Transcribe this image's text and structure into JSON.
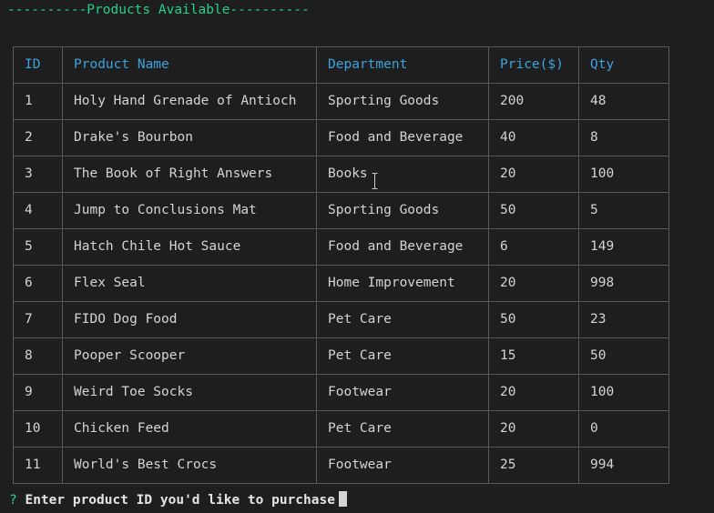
{
  "banner": "----------Products Available----------",
  "table": {
    "headers": {
      "id": "ID",
      "name": "Product Name",
      "department": "Department",
      "price": "Price($)",
      "qty": "Qty"
    },
    "rows": [
      {
        "id": "1",
        "name": "Holy Hand Grenade of Antioch",
        "department": "Sporting Goods",
        "price": "200",
        "qty": "48"
      },
      {
        "id": "2",
        "name": "Drake's Bourbon",
        "department": "Food and Beverage",
        "price": "40",
        "qty": "8"
      },
      {
        "id": "3",
        "name": "The Book of Right Answers",
        "department": "Books",
        "price": "20",
        "qty": "100"
      },
      {
        "id": "4",
        "name": "Jump to Conclusions Mat",
        "department": "Sporting Goods",
        "price": "50",
        "qty": "5"
      },
      {
        "id": "5",
        "name": "Hatch Chile Hot Sauce",
        "department": "Food and Beverage",
        "price": "6",
        "qty": "149"
      },
      {
        "id": "6",
        "name": "Flex Seal",
        "department": "Home Improvement",
        "price": "20",
        "qty": "998"
      },
      {
        "id": "7",
        "name": "FIDO Dog Food",
        "department": "Pet Care",
        "price": "50",
        "qty": "23"
      },
      {
        "id": "8",
        "name": "Pooper Scooper",
        "department": "Pet Care",
        "price": "15",
        "qty": "50"
      },
      {
        "id": "9",
        "name": "Weird Toe Socks",
        "department": "Footwear",
        "price": "20",
        "qty": "100"
      },
      {
        "id": "10",
        "name": "Chicken Feed",
        "department": "Pet Care",
        "price": "20",
        "qty": "0"
      },
      {
        "id": "11",
        "name": "World's Best Crocs",
        "department": "Footwear",
        "price": "25",
        "qty": "994"
      }
    ]
  },
  "prompt": {
    "marker": "?",
    "text": "Enter product ID you'd like to purchase"
  },
  "colors": {
    "background": "#1e1e1e",
    "banner": "#23d18b",
    "header_text": "#3ba3e0",
    "cell_text": "#d4d4d4",
    "border": "#5a5a5a"
  },
  "icons": {
    "mouse_pointer": "i-beam-cursor-icon",
    "text_cursor": "block-cursor-icon"
  }
}
